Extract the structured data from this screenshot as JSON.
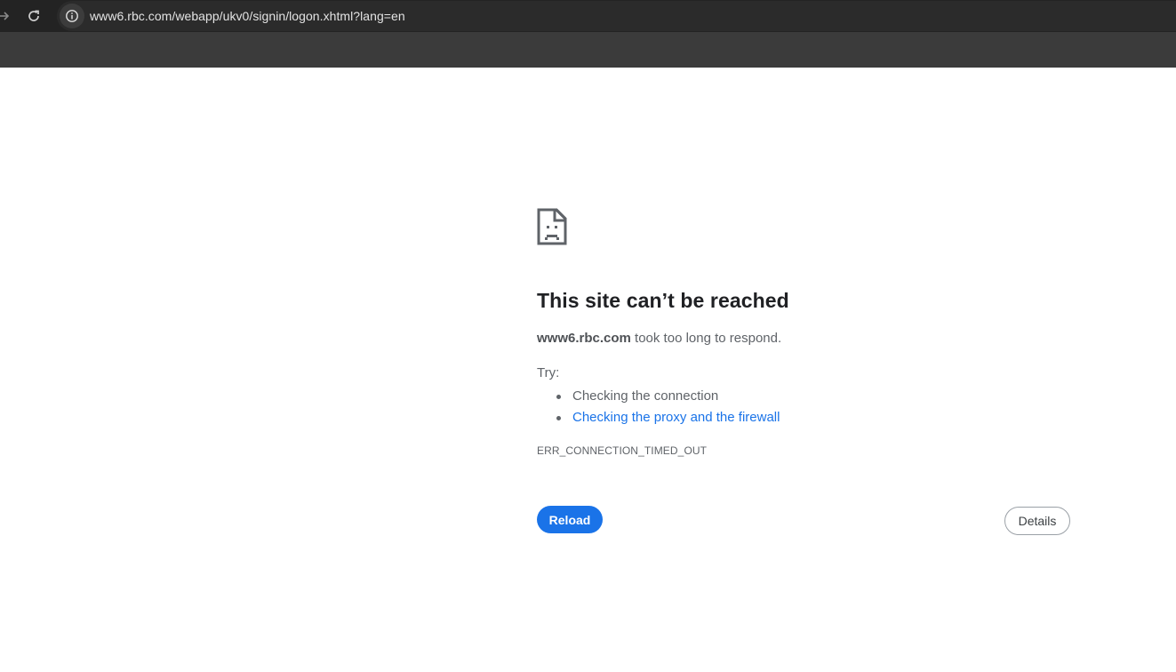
{
  "browser": {
    "url": "www6.rbc.com/webapp/ukv0/signin/logon.xhtml?lang=en",
    "icons": {
      "forward": "forward-arrow-icon",
      "reload": "reload-icon",
      "site_info": "info-icon"
    }
  },
  "error_page": {
    "icon": "sad-document-icon",
    "title": "This site can’t be reached",
    "host": "www6.rbc.com",
    "message": " took too long to respond.",
    "try_label": "Try:",
    "suggestions": [
      "Checking the connection",
      "Checking the proxy and the firewall"
    ],
    "error_code": "ERR_CONNECTION_TIMED_OUT",
    "reload_label": "Reload",
    "details_label": "Details"
  },
  "colors": {
    "accent": "#1a73e8",
    "toolbar": "#232323",
    "bookmarks_bar": "#3b3b3b"
  }
}
